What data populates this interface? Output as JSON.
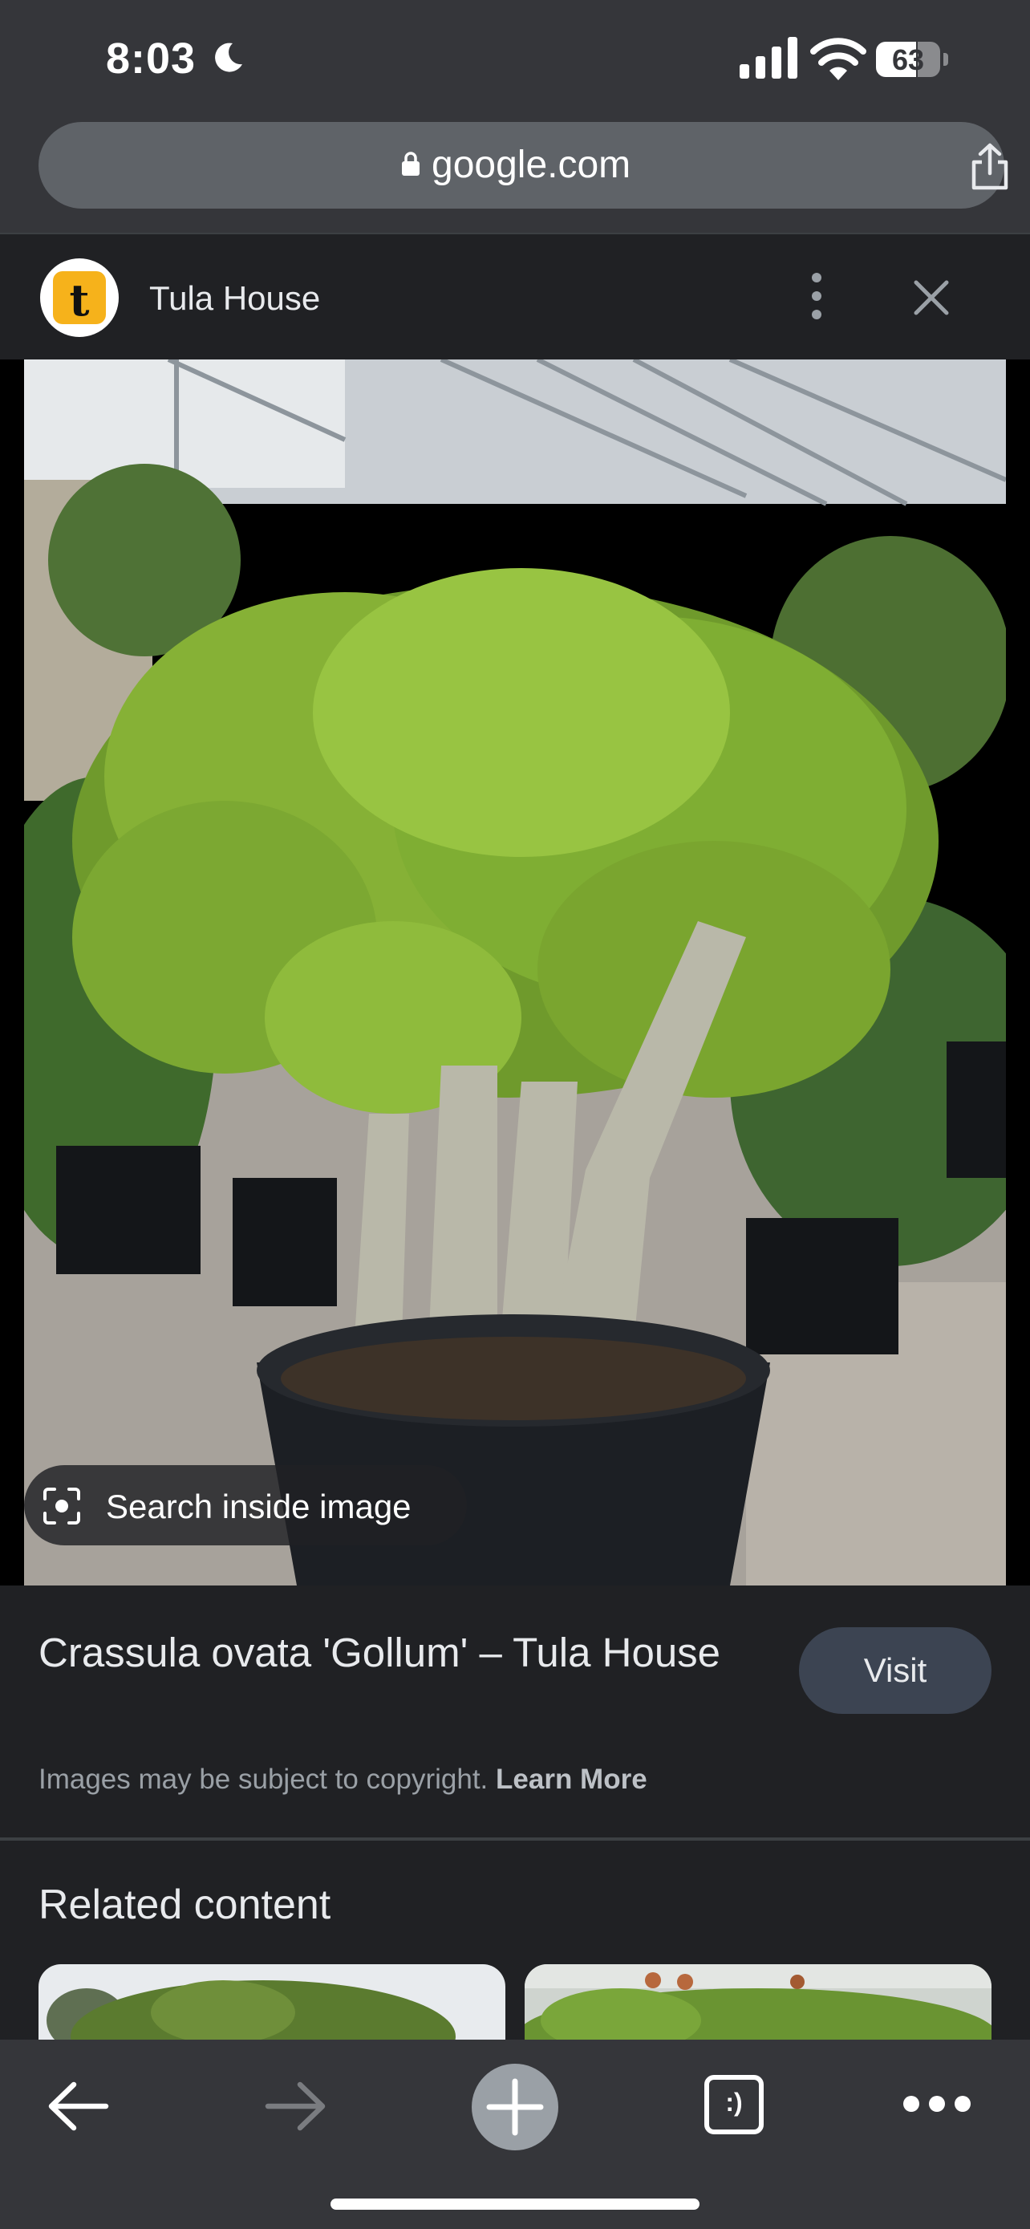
{
  "status_bar": {
    "time": "8:03",
    "battery": "63"
  },
  "browser": {
    "url": "google.com"
  },
  "source": {
    "name": "Tula House",
    "favicon_letter": "t"
  },
  "image_viewer": {
    "search_inside_label": "Search inside image"
  },
  "result": {
    "title": "Crassula ovata 'Gollum' – Tula House",
    "visit_label": "Visit",
    "copyright_text": "Images may be subject to copyright.",
    "learn_more_label": "Learn More"
  },
  "related": {
    "title": "Related content"
  },
  "toolbar": {
    "tabs_label": ":)"
  },
  "icons": [
    "moon-icon",
    "signal-icon",
    "wifi-icon",
    "battery-icon",
    "lock-icon",
    "share-icon",
    "more-vert-icon",
    "close-icon",
    "lens-icon",
    "back-arrow-icon",
    "forward-arrow-icon",
    "plus-icon",
    "tabs-icon",
    "more-horiz-icon"
  ],
  "colors": {
    "chrome_bar": "#35363a",
    "background": "#202124",
    "visit_button": "#3c4452",
    "favicon_bg": "#f6b21b"
  }
}
